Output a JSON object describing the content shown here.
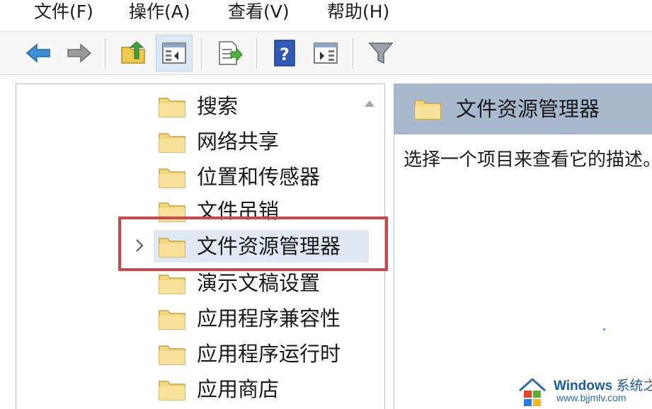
{
  "menubar": {
    "items": [
      {
        "label": "文件(F)"
      },
      {
        "label": "操作(A)"
      },
      {
        "label": "查看(V)"
      },
      {
        "label": "帮助(H)"
      }
    ]
  },
  "toolbar": {
    "icons": [
      "back-arrow-icon",
      "forward-arrow-icon",
      "up-folder-icon",
      "show-hide-tree-icon",
      "export-list-icon",
      "help-icon",
      "show-hide-action-pane-icon",
      "filter-icon"
    ]
  },
  "tree": {
    "items": [
      {
        "label": "搜索"
      },
      {
        "label": "网络共享"
      },
      {
        "label": "位置和传感器"
      },
      {
        "label": "文件吊销"
      },
      {
        "label": "文件资源管理器",
        "selected": true,
        "expandable": true
      },
      {
        "label": "演示文稿设置"
      },
      {
        "label": "应用程序兼容性"
      },
      {
        "label": "应用程序运行时"
      },
      {
        "label": "应用商店"
      }
    ]
  },
  "details": {
    "title": "文件资源管理器",
    "description": "选择一个项目来查看它的描述。"
  },
  "watermark": {
    "brand": "Windows",
    "brand_suffix": "系统之家",
    "url": "www.bjjmlv.com"
  },
  "colors": {
    "highlight_border": "#cf4646",
    "header_bg": "#a8b9cd",
    "selection_bg": "#dfe8f3",
    "folder_fill": "#f4d77a"
  }
}
